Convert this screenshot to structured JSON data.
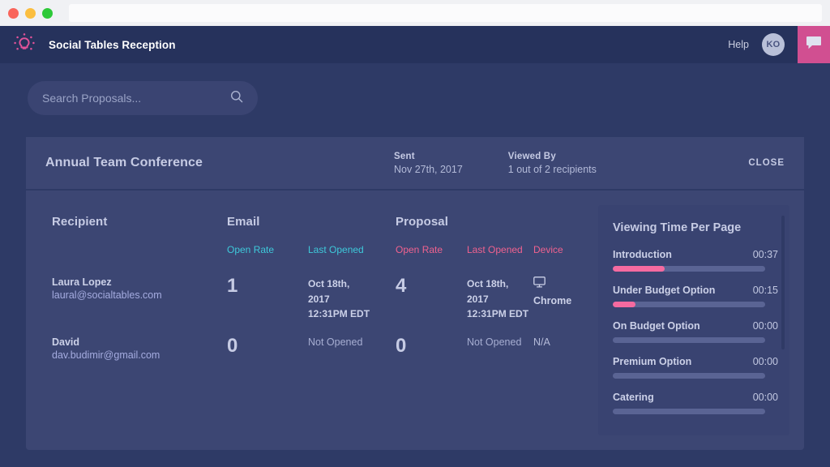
{
  "window": {
    "traffic_lights": [
      "close",
      "minimize",
      "maximize"
    ],
    "url_value": ""
  },
  "header": {
    "logo_icon": "lightbulb-idea-icon",
    "app_title": "Social Tables Reception",
    "help_label": "Help",
    "avatar_initials": "KO",
    "chat_icon": "speech-bubble-icon",
    "accent_pink": "#d14f91",
    "background": "#26325c"
  },
  "search": {
    "placeholder": "Search Proposals...",
    "value": "",
    "icon": "search-icon"
  },
  "card": {
    "proposal_name": "Annual Team Conference",
    "sent": {
      "label": "Sent",
      "value": "Nov 27th, 2017"
    },
    "viewed_by": {
      "label": "Viewed By",
      "value": "1 out of 2 recipients"
    },
    "close_label": "CLOSE"
  },
  "table": {
    "groups": {
      "recipient": "Recipient",
      "email": "Email",
      "proposal": "Proposal"
    },
    "subheaders": {
      "email_open_rate": "Open Rate",
      "email_last_opened": "Last Opened",
      "proposal_open_rate": "Open Rate",
      "proposal_last_opened": "Last Opened",
      "proposal_device": "Device"
    },
    "colors": {
      "email_accent": "#3ec9da",
      "proposal_accent": "#f0628f"
    },
    "rows": [
      {
        "name": "Laura Lopez",
        "email": "laural@socialtables.com",
        "email_open_rate": "1",
        "email_last_opened": "Oct 18th,\n2017\n12:31PM EDT",
        "email_last_opened_lines": [
          "Oct 18th,",
          "2017",
          "12:31PM EDT"
        ],
        "proposal_open_rate": "4",
        "proposal_last_opened_lines": [
          "Oct 18th,",
          "2017",
          "12:31PM EDT"
        ],
        "device_icon": "desktop-monitor-icon",
        "device": "Chrome"
      },
      {
        "name": "David",
        "email": "dav.budimir@gmail.com",
        "email_open_rate": "0",
        "email_last_opened_lines": [
          "Not Opened"
        ],
        "proposal_open_rate": "0",
        "proposal_last_opened_lines": [
          "Not Opened"
        ],
        "device_icon": "none",
        "device": "N/A"
      }
    ]
  },
  "viewing_time": {
    "title": "Viewing Time Per Page",
    "bar_color": "#f56aa0",
    "track_color": "#5a6494",
    "pages": [
      {
        "name": "Introduction",
        "time": "00:37",
        "percent": 34
      },
      {
        "name": "Under Budget Option",
        "time": "00:15",
        "percent": 15
      },
      {
        "name": "On Budget Option",
        "time": "00:00",
        "percent": 0
      },
      {
        "name": "Premium Option",
        "time": "00:00",
        "percent": 0
      },
      {
        "name": "Catering",
        "time": "00:00",
        "percent": 0
      }
    ]
  }
}
